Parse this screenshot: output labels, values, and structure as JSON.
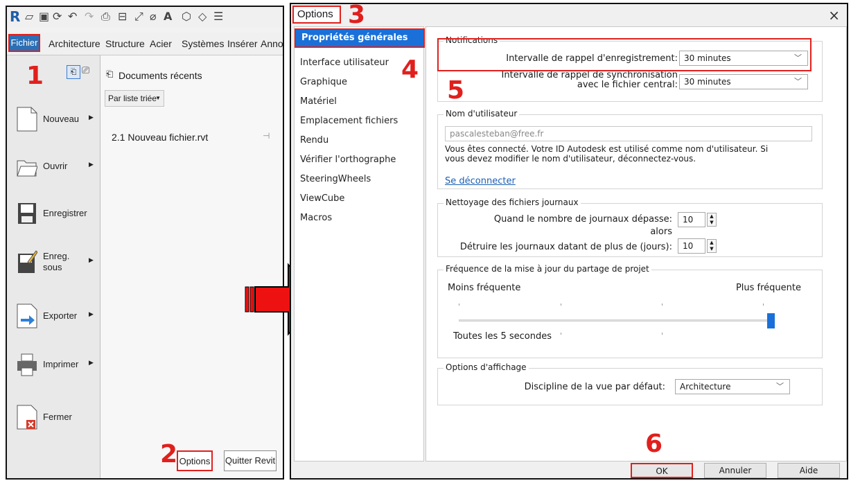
{
  "revit": {
    "ribbon_tabs": [
      "Fichier",
      "Architecture",
      "Structure",
      "Acier",
      "Systèmes",
      "Insérer",
      "Annot"
    ],
    "recent_docs_title": "Documents récents",
    "sort_label": "Par liste triée",
    "recent_file": "2.1 Nouveau fichier.rvt",
    "menu": {
      "nouveau": "Nouveau",
      "ouvrir": "Ouvrir",
      "enregistrer": "Enregistrer",
      "enreg1": "Enreg.",
      "enreg2": "sous",
      "exporter": "Exporter",
      "imprimer": "Imprimer",
      "fermer": "Fermer"
    },
    "options_button": "Options",
    "quit_button": "Quitter Revit"
  },
  "annotations": [
    "1",
    "2",
    "3",
    "4",
    "5",
    "6"
  ],
  "dialog": {
    "title": "Options",
    "close": "×",
    "nav": [
      "Propriétés générales",
      "Interface utilisateur",
      "Graphique",
      "Matériel",
      "Emplacement fichiers",
      "Rendu",
      "Vérifier l'orthographe",
      "SteeringWheels",
      "ViewCube",
      "Macros"
    ],
    "notifications": {
      "label": "Notifications",
      "save_reminder_label": "Intervalle de rappel d'enregistrement:",
      "save_reminder_value": "30 minutes",
      "sync_label_1": "Intervalle de rappel de synchronisation",
      "sync_label_2": "avec le fichier central:",
      "sync_value": "30 minutes"
    },
    "username": {
      "label": "Nom d'utilisateur",
      "value": "pascalesteban@free.fr",
      "info_1": "Vous êtes connecté. Votre ID Autodesk est utilisé comme nom d'utilisateur. Si",
      "info_2": "vous devez modifier le nom d'utilisateur, déconnectez-vous.",
      "logout_link": "Se déconnecter"
    },
    "journals": {
      "label": "Nettoyage des fichiers journaux",
      "count_label": "Quand le nombre de journaux dépasse:",
      "alors": "alors",
      "count_value": "10",
      "days_label": "Détruire les journaux datant de plus de (jours):",
      "days_value": "10"
    },
    "worksharing": {
      "label": "Fréquence de la mise à jour du partage de projet",
      "less": "Moins fréquente",
      "more": "Plus fréquente",
      "slider_value": 1.0,
      "status": "Toutes les 5 secondes"
    },
    "display": {
      "label": "Options d'affichage",
      "discipline_label": "Discipline de la vue par défaut:",
      "discipline_value": "Architecture"
    },
    "buttons": {
      "ok": "OK",
      "cancel": "Annuler",
      "help": "Aide"
    }
  },
  "colors": {
    "annotation_red": "#e0201d",
    "selection_blue": "#1a70d8",
    "revit_blue": "#2c6fb5",
    "arrow_red": "#ee1111"
  }
}
